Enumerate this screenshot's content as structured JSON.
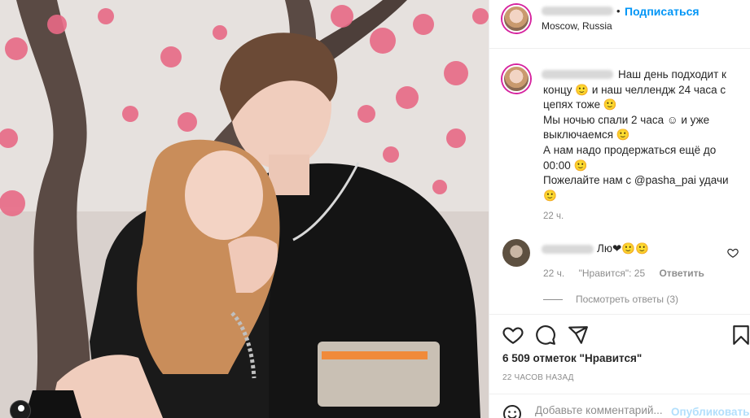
{
  "post": {
    "location": "Moscow, Russia",
    "follow_label": "Подписаться",
    "separator": "•"
  },
  "caption": {
    "text": "Наш день подходит к концу 🙂 и наш челлендж 24 часа с цепях тоже 🙂\nМы ночью спали 2 часа ☺ и уже выключаемся 🙂\nА нам надо продержаться ещё до 00:00 🙂\nПожелайте нам с @pasha_pai удачи 🙂",
    "time": "22 ч."
  },
  "comment": {
    "text": "Лю❤🙂🙂",
    "time": "22 ч.",
    "likes_label": "\"Нравится\": 25",
    "reply_label": "Ответить",
    "view_replies": "Посмотреть ответы (3)"
  },
  "actions": {
    "likes_count": "6 509 отметок \"Нравится\"",
    "post_time": "22 ЧАСОВ НАЗАД"
  },
  "add_comment": {
    "placeholder": "Добавьте комментарий...",
    "publish_label": "Опубликовать"
  },
  "icons": {
    "like": "heart-icon",
    "comment": "comment-icon",
    "share": "share-icon",
    "save": "bookmark-icon",
    "emoji": "smile-icon",
    "user": "user-tag-icon"
  },
  "colors": {
    "accent": "#0095f6",
    "publish_disabled": "#b2dffc",
    "muted": "#8e8e8e",
    "text": "#262626"
  }
}
